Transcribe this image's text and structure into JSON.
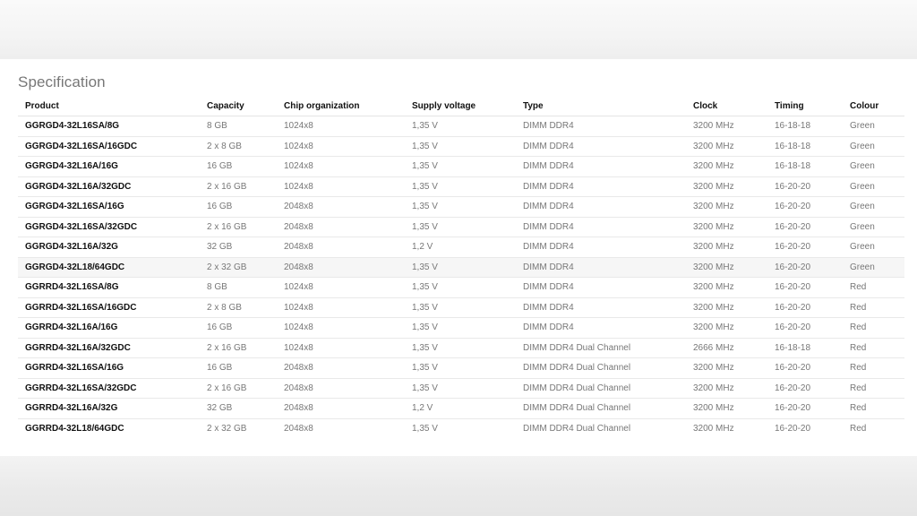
{
  "heading": "Specification",
  "table": {
    "columns": [
      "Product",
      "Capacity",
      "Chip organization",
      "Supply voltage",
      "Type",
      "Clock",
      "Timing",
      "Colour"
    ],
    "rows": [
      [
        "GGRGD4-32L16SA/8G",
        "8 GB",
        "1024x8",
        "1,35 V",
        "DIMM DDR4",
        "3200 MHz",
        "16-18-18",
        "Green"
      ],
      [
        "GGRGD4-32L16SA/16GDC",
        "2 x 8 GB",
        "1024x8",
        "1,35 V",
        "DIMM DDR4",
        "3200 MHz",
        "16-18-18",
        "Green"
      ],
      [
        "GGRGD4-32L16A/16G",
        "16 GB",
        "1024x8",
        "1,35 V",
        "DIMM DDR4",
        "3200 MHz",
        "16-18-18",
        "Green"
      ],
      [
        "GGRGD4-32L16A/32GDC",
        "2 x 16 GB",
        "1024x8",
        "1,35 V",
        "DIMM DDR4",
        "3200 MHz",
        "16-20-20",
        "Green"
      ],
      [
        "GGRGD4-32L16SA/16G",
        "16 GB",
        "2048x8",
        "1,35 V",
        "DIMM DDR4",
        "3200 MHz",
        "16-20-20",
        "Green"
      ],
      [
        "GGRGD4-32L16SA/32GDC",
        "2 x 16 GB",
        "2048x8",
        "1,35 V",
        "DIMM DDR4",
        "3200 MHz",
        "16-20-20",
        "Green"
      ],
      [
        "GGRGD4-32L16A/32G",
        "32 GB",
        "2048x8",
        "1,2 V",
        "DIMM DDR4",
        "3200 MHz",
        "16-20-20",
        "Green"
      ],
      [
        "GGRGD4-32L18/64GDC",
        "2 x 32 GB",
        "2048x8",
        "1,35 V",
        "DIMM DDR4",
        "3200 MHz",
        "16-20-20",
        "Green"
      ],
      [
        "GGRRD4-32L16SA/8G",
        "8 GB",
        "1024x8",
        "1,35 V",
        "DIMM DDR4",
        "3200 MHz",
        "16-20-20",
        "Red"
      ],
      [
        "GGRRD4-32L16SA/16GDC",
        "2 x 8 GB",
        "1024x8",
        "1,35 V",
        "DIMM DDR4",
        "3200 MHz",
        "16-20-20",
        "Red"
      ],
      [
        "GGRRD4-32L16A/16G",
        "16 GB",
        "1024x8",
        "1,35 V",
        "DIMM DDR4",
        "3200 MHz",
        "16-20-20",
        "Red"
      ],
      [
        "GGRRD4-32L16A/32GDC",
        "2 x 16 GB",
        "1024x8",
        "1,35 V",
        "DIMM DDR4 Dual Channel",
        "2666 MHz",
        "16-18-18",
        "Red"
      ],
      [
        "GGRRD4-32L16SA/16G",
        "16 GB",
        "2048x8",
        "1,35 V",
        "DIMM DDR4 Dual Channel",
        "3200 MHz",
        "16-20-20",
        "Red"
      ],
      [
        "GGRRD4-32L16SA/32GDC",
        "2 x 16 GB",
        "2048x8",
        "1,35 V",
        "DIMM DDR4 Dual Channel",
        "3200 MHz",
        "16-20-20",
        "Red"
      ],
      [
        "GGRRD4-32L16A/32G",
        "32 GB",
        "2048x8",
        "1,2 V",
        "DIMM DDR4 Dual Channel",
        "3200 MHz",
        "16-20-20",
        "Red"
      ],
      [
        "GGRRD4-32L18/64GDC",
        "2 x 32 GB",
        "2048x8",
        "1,35 V",
        "DIMM DDR4 Dual Channel",
        "3200 MHz",
        "16-20-20",
        "Red"
      ]
    ],
    "highlighted_row": 7
  },
  "colors": {
    "header_text": "#111111",
    "cell_text": "#777777",
    "heading_text": "#777777",
    "row_highlight": "#f6f6f6"
  }
}
